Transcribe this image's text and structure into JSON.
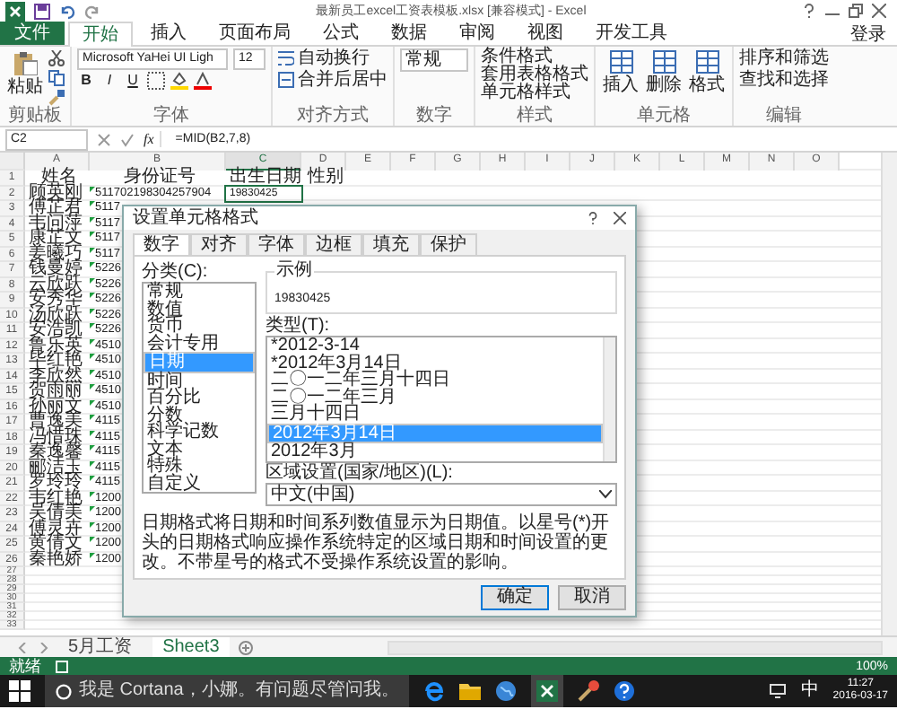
{
  "window": {
    "title": "最新员工excel工资表模板.xlsx [兼容模式] - Excel",
    "account": "登录"
  },
  "ribbon_tabs": [
    {
      "label": "文件",
      "kind": "file",
      "selected": false
    },
    {
      "label": "开始",
      "kind": "tab",
      "selected": true
    },
    {
      "label": "插入",
      "kind": "tab",
      "selected": false
    },
    {
      "label": "页面布局",
      "kind": "tab",
      "selected": false
    },
    {
      "label": "公式",
      "kind": "tab",
      "selected": false
    },
    {
      "label": "数据",
      "kind": "tab",
      "selected": false
    },
    {
      "label": "审阅",
      "kind": "tab",
      "selected": false
    },
    {
      "label": "视图",
      "kind": "tab",
      "selected": false
    },
    {
      "label": "开发工具",
      "kind": "tab",
      "selected": false
    }
  ],
  "ribbon": {
    "clipboard": {
      "paste": "粘贴",
      "label": "剪贴板"
    },
    "font": {
      "name": "Microsoft YaHei UI Ligh",
      "size": "12",
      "styles": [
        {
          "label": "B",
          "kind": "bold"
        },
        {
          "label": "I",
          "kind": "italic"
        },
        {
          "label": "U",
          "kind": "underline"
        }
      ],
      "label": "字体"
    },
    "alignment": {
      "wrap": "自动换行",
      "merge": "合并后居中",
      "label": "对齐方式"
    },
    "number": {
      "format": "常规",
      "label": "数字"
    },
    "styles": {
      "buttons": [
        "条件格式",
        "套用表格格式",
        "单元格样式"
      ],
      "label": "样式"
    },
    "cells": {
      "buttons": [
        "插入",
        "删除",
        "格式"
      ],
      "label": "单元格"
    },
    "editing": {
      "buttons": [
        "排序和筛选",
        "查找和选择"
      ],
      "label": "编辑"
    }
  },
  "formula_bar": {
    "name_box": "C2",
    "function_label": "fx",
    "formula": "=MID(B2,7,8)"
  },
  "sheet": {
    "columns": [
      "A",
      "B",
      "C",
      "D",
      "E",
      "F",
      "G",
      "H",
      "I",
      "J",
      "K",
      "L",
      "M",
      "N",
      "O"
    ],
    "rows": [
      {
        "number": "1",
        "kind": "header",
        "cells": [
          "姓名",
          "身份证号",
          "出生日期",
          "性别"
        ]
      },
      {
        "number": "2",
        "kind": "data",
        "name": "顾英刚",
        "id": "511702198304257904",
        "birth": {
          "text": "19830425",
          "selected": true
        }
      },
      {
        "number": "3",
        "kind": "data",
        "name": "傅芷君",
        "id": "5117"
      },
      {
        "number": "4",
        "kind": "data",
        "name": "韦问萍",
        "id": "5117"
      },
      {
        "number": "5",
        "kind": "data",
        "name": "康芷文",
        "id": "5117"
      },
      {
        "number": "6",
        "kind": "data",
        "name": "姜曦巧",
        "id": "5117"
      },
      {
        "number": "7",
        "kind": "data",
        "name": "钱曼婷",
        "id": "5226"
      },
      {
        "number": "8",
        "kind": "data",
        "name": "云欣跃",
        "id": "5226"
      },
      {
        "number": "9",
        "kind": "data",
        "name": "安秀华",
        "id": "5226"
      },
      {
        "number": "10",
        "kind": "data",
        "name": "汤欣跃",
        "id": "5226"
      },
      {
        "number": "11",
        "kind": "data",
        "name": "安浩凯",
        "id": "5226"
      },
      {
        "number": "12",
        "kind": "data",
        "name": "鲁乐英",
        "id": "4510"
      },
      {
        "number": "13",
        "kind": "data",
        "name": "毕红艳",
        "id": "4510"
      },
      {
        "number": "14",
        "kind": "data",
        "name": "李欣然",
        "id": "4510"
      },
      {
        "number": "15",
        "kind": "data",
        "name": "贺雨丽",
        "id": "4510"
      },
      {
        "number": "16",
        "kind": "data",
        "name": "孙丽文",
        "id": "4510"
      },
      {
        "number": "17",
        "kind": "data",
        "name": "曹逸美",
        "id": "4115"
      },
      {
        "number": "18",
        "kind": "data",
        "name": "冯惜珠",
        "id": "4115"
      },
      {
        "number": "19",
        "kind": "data",
        "name": "秦逸馨",
        "id": "4115"
      },
      {
        "number": "20",
        "kind": "data",
        "name": "郦洁玉",
        "id": "4115"
      },
      {
        "number": "21",
        "kind": "data",
        "name": "罗玲玲",
        "id": "4115"
      },
      {
        "number": "22",
        "kind": "data",
        "name": "韦红艳",
        "id": "1200"
      },
      {
        "number": "23",
        "kind": "data",
        "name": "吴倩美",
        "id": "1200"
      },
      {
        "number": "24",
        "kind": "data",
        "name": "傅灵卉",
        "id": "1200"
      },
      {
        "number": "25",
        "kind": "data",
        "name": "黄倩文",
        "id": "1200"
      },
      {
        "number": "26",
        "kind": "data",
        "name": "秦艳娇",
        "id": "1200"
      },
      {
        "number": "27",
        "kind": "empty"
      },
      {
        "number": "28",
        "kind": "empty"
      },
      {
        "number": "29",
        "kind": "empty"
      },
      {
        "number": "30",
        "kind": "empty"
      },
      {
        "number": "31",
        "kind": "empty"
      },
      {
        "number": "32",
        "kind": "empty"
      },
      {
        "number": "33",
        "kind": "empty"
      }
    ]
  },
  "dialog": {
    "title": "设置单元格格式",
    "tabs": [
      {
        "label": "数字",
        "selected": true
      },
      {
        "label": "对齐",
        "selected": false
      },
      {
        "label": "字体",
        "selected": false
      },
      {
        "label": "边框",
        "selected": false
      },
      {
        "label": "填充",
        "selected": false
      },
      {
        "label": "保护",
        "selected": false
      }
    ],
    "category_label": "分类(C):",
    "categories": [
      {
        "label": "常规",
        "selected": false
      },
      {
        "label": "数值",
        "selected": false
      },
      {
        "label": "货币",
        "selected": false
      },
      {
        "label": "会计专用",
        "selected": false
      },
      {
        "label": "日期",
        "selected": true
      },
      {
        "label": "时间",
        "selected": false
      },
      {
        "label": "百分比",
        "selected": false
      },
      {
        "label": "分数",
        "selected": false
      },
      {
        "label": "科学记数",
        "selected": false
      },
      {
        "label": "文本",
        "selected": false
      },
      {
        "label": "特殊",
        "selected": false
      },
      {
        "label": "自定义",
        "selected": false
      }
    ],
    "sample_label": "示例",
    "sample": "19830425",
    "type_label": "类型(T):",
    "types": [
      {
        "label": "*2012-3-14",
        "selected": false
      },
      {
        "label": "*2012年3月14日",
        "selected": false
      },
      {
        "label": "二〇一二年三月十四日",
        "selected": false
      },
      {
        "label": "二〇一二年三月",
        "selected": false
      },
      {
        "label": "三月十四日",
        "selected": false
      },
      {
        "label": "2012年3月14日",
        "selected": true
      },
      {
        "label": "2012年3月",
        "selected": false
      }
    ],
    "locale_label": "区域设置(国家/地区)(L):",
    "locale": "中文(中国)",
    "description": "日期格式将日期和时间系列数值显示为日期值。以星号(*)开头的日期格式响应操作系统特定的区域日期和时间设置的更改。不带星号的格式不受操作系统设置的影响。",
    "buttons": [
      {
        "label": "确定",
        "kind": "primary"
      },
      {
        "label": "取消",
        "kind": "normal"
      }
    ]
  },
  "sheet_tabs": [
    {
      "label": "5月工资",
      "selected": false
    },
    {
      "label": "Sheet3",
      "selected": true
    }
  ],
  "status_bar": {
    "text": "就绪",
    "zoom": "100%"
  },
  "taskbar": {
    "search_placeholder": "我是 Cortana，小娜。有问题尽管问我。",
    "ime": "中",
    "time": "11:27",
    "date": "2016-03-17"
  }
}
